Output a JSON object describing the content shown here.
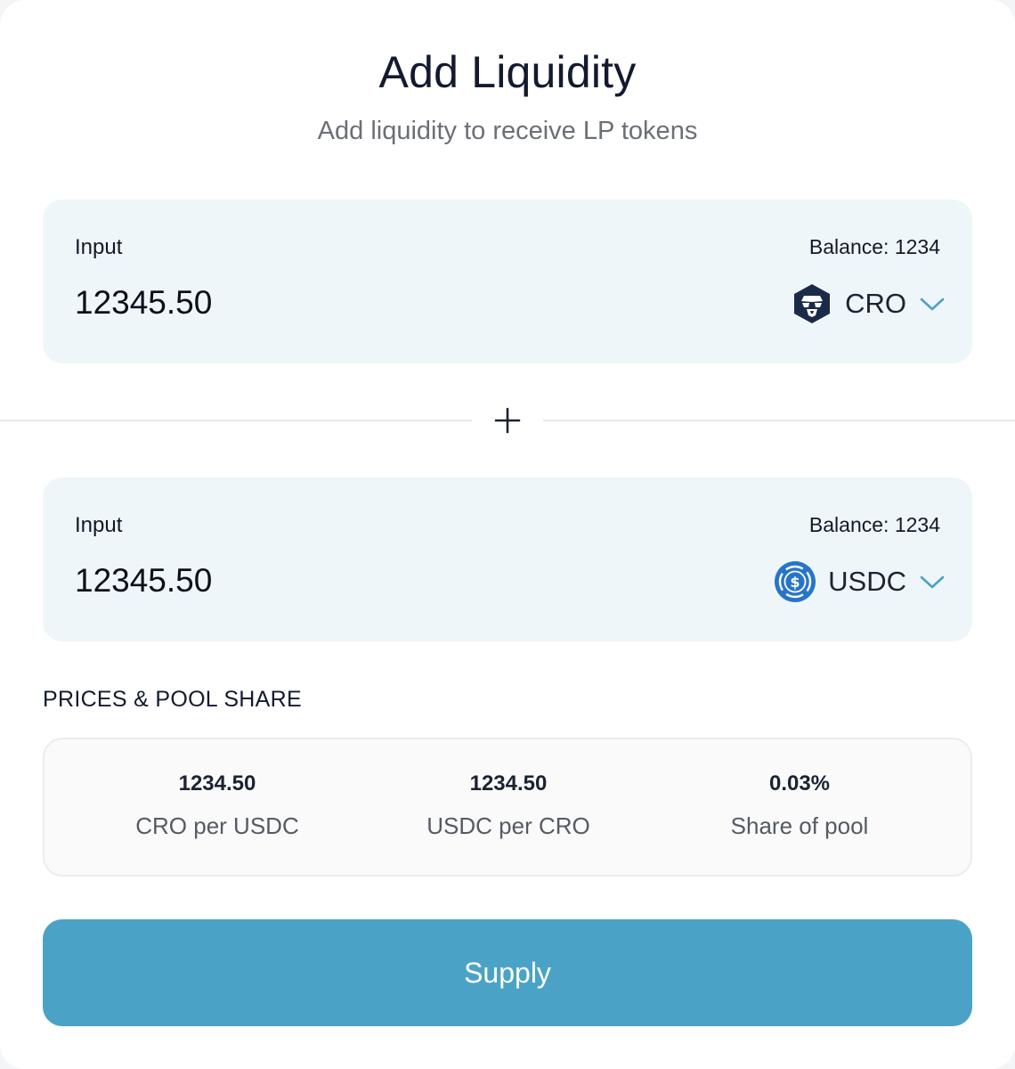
{
  "header": {
    "title": "Add Liquidity",
    "subtitle": "Add liquidity to receive LP tokens"
  },
  "inputs": [
    {
      "label": "Input",
      "balance": "Balance: 1234",
      "amount": "12345.50",
      "token": {
        "symbol": "CRO",
        "icon": "cro-icon"
      }
    },
    {
      "label": "Input",
      "balance": "Balance: 1234",
      "amount": "12345.50",
      "token": {
        "symbol": "USDC",
        "icon": "usdc-icon"
      }
    }
  ],
  "separator_icon": "plus-icon",
  "prices": {
    "section_label": "PRICES & POOL SHARE",
    "items": [
      {
        "value": "1234.50",
        "caption": "CRO per USDC"
      },
      {
        "value": "1234.50",
        "caption": "USDC per CRO"
      },
      {
        "value": "0.03%",
        "caption": "Share of pool"
      }
    ]
  },
  "supply_button": {
    "label": "Supply"
  },
  "colors": {
    "accent": "#4aa3c6",
    "input_bg": "#eff6f9",
    "chevron": "#4aa3c6",
    "cro_icon": "#1c2a4a",
    "usdc_icon": "#2775ca"
  }
}
